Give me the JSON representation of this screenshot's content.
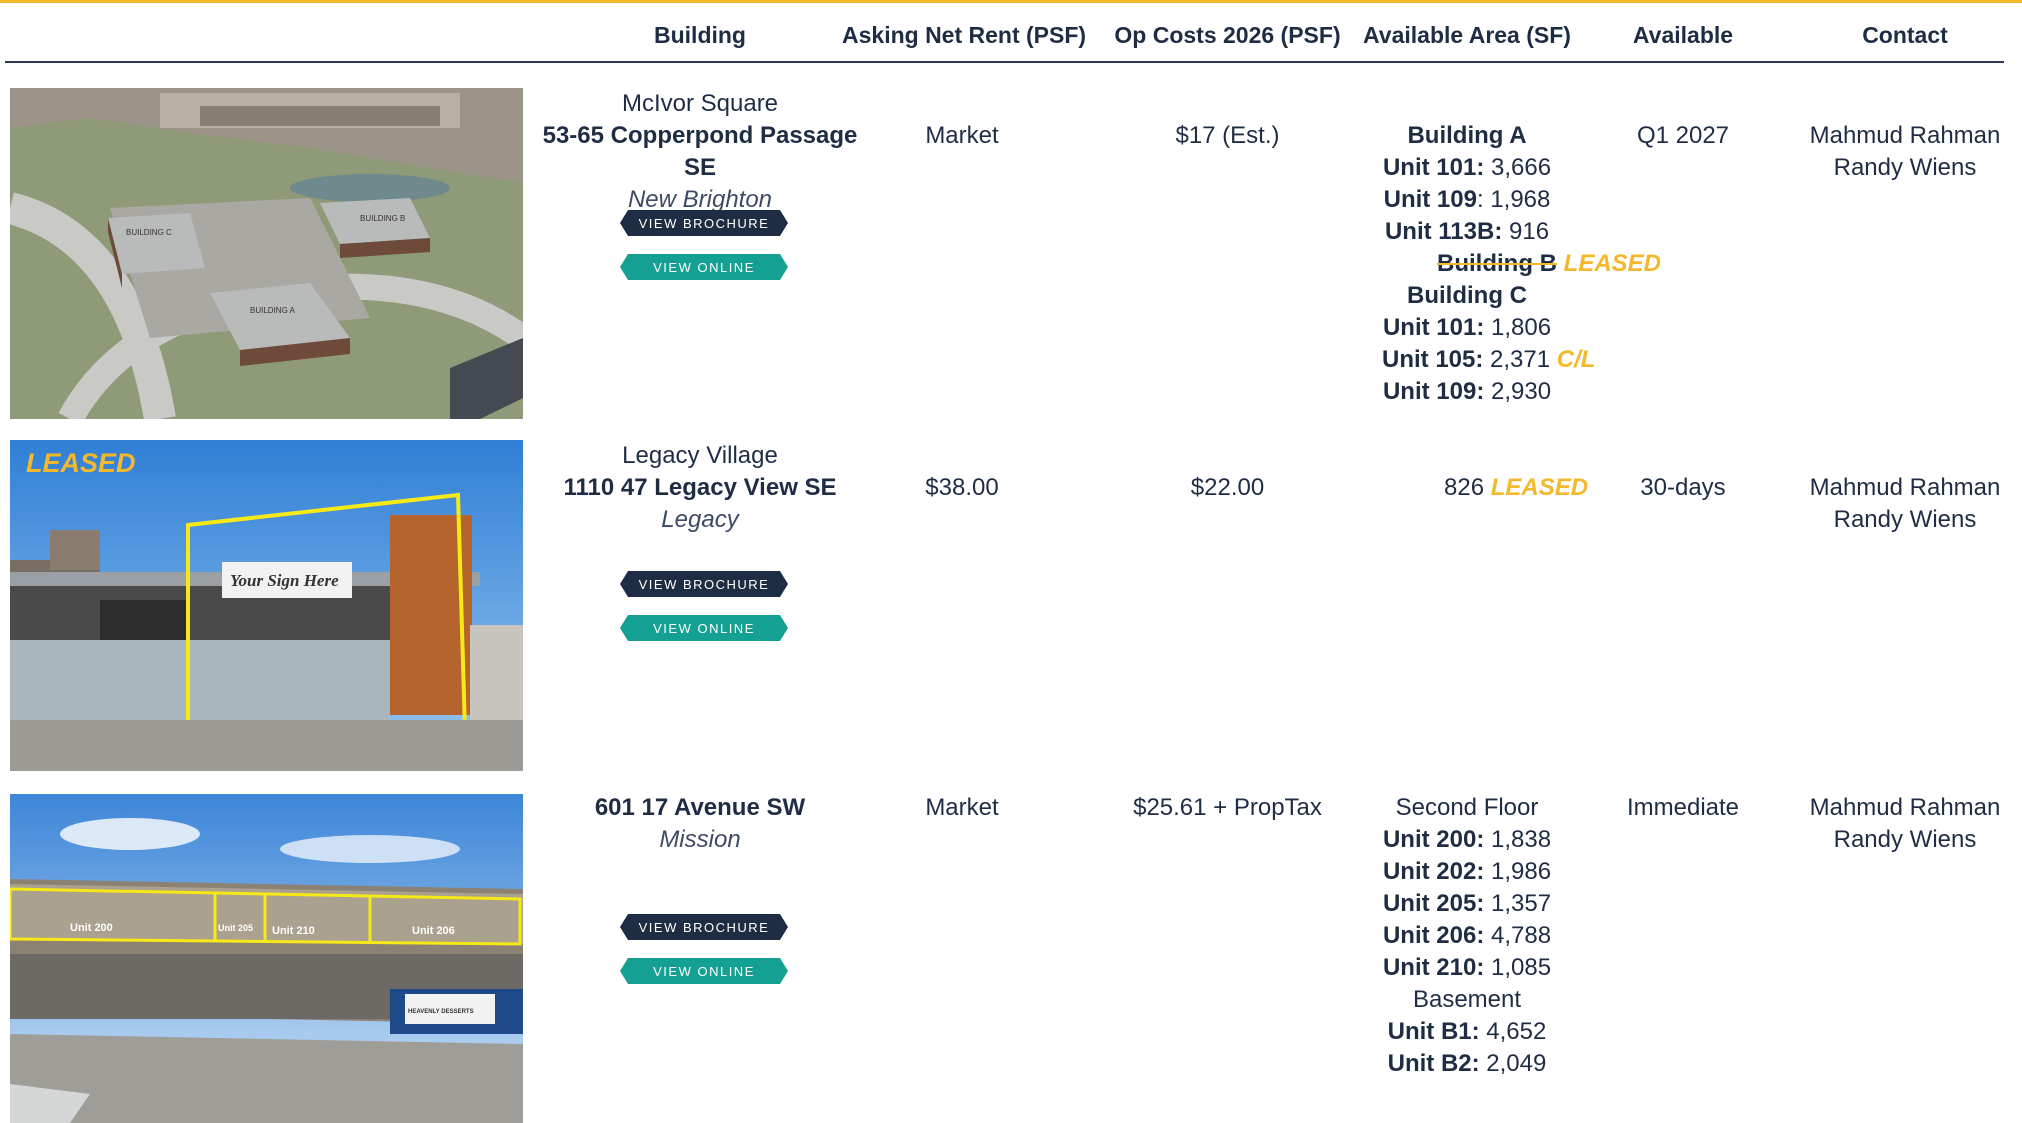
{
  "headers": {
    "building": "Building",
    "asking": "Asking Net Rent (PSF)",
    "opcosts": "Op Costs 2026 (PSF)",
    "area": "Available Area (SF)",
    "available": "Available",
    "contact": "Contact"
  },
  "buttons": {
    "brochure": "VIEW BROCHURE",
    "online": "VIEW ONLINE"
  },
  "colors": {
    "accent": "#f3b82c",
    "navy": "#1f2d44",
    "teal": "#14a193"
  },
  "rows": [
    {
      "photo_labels": [
        "BUILDING C",
        "BUILDING B",
        "BUILDING A"
      ],
      "name": "McIvor Square",
      "address": "53-65 Copperpond Passage SE",
      "area": "New Brighton",
      "asking": "Market",
      "opcosts": "$17 (Est.)",
      "available": "Q1 2027",
      "contact": [
        "Mahmud Rahman",
        "Randy Wiens"
      ],
      "units": {
        "bldg_a": "Building A",
        "a1_label": "Unit 101:",
        "a1_val": " 3,666",
        "a2_label": "Unit 109",
        "a2_val": ": 1,968",
        "a3_label": "Unit 113B:",
        "a3_val": " 916",
        "bldg_b": "Building B",
        "bldg_b_status": "LEASED",
        "bldg_c": "Building C",
        "c1_label": "Unit 101:",
        "c1_val": " 1,806",
        "c2_label": "Unit 105:",
        "c2_val": " 2,371",
        "c2_status": "C/L",
        "c3_label": "Unit 109:",
        "c3_val": " 2,930"
      }
    },
    {
      "leased_tag": "LEASED",
      "sign_text": "Your Sign Here",
      "name": "Legacy Village",
      "address": "1110 47 Legacy View SE",
      "area": "Legacy",
      "asking": "$38.00",
      "opcosts": "$22.00",
      "area_value": "826",
      "area_status": "LEASED",
      "available": "30-days",
      "contact": [
        "Mahmud Rahman",
        "Randy Wiens"
      ]
    },
    {
      "photo_labels": [
        "Unit 200",
        "Unit 205",
        "Unit 210",
        "Unit 206",
        "HEAVENLY DESSERTS"
      ],
      "address": "601 17 Avenue SW",
      "area": "Mission",
      "asking": "Market",
      "opcosts": "$25.61 + PropTax",
      "available": "Immediate",
      "contact": [
        "Mahmud Rahman",
        "Randy Wiens"
      ],
      "units": {
        "second_floor": "Second Floor",
        "u1_label": "Unit 200:",
        "u1_val": " 1,838",
        "u2_label": "Unit 202:",
        "u2_val": " 1,986",
        "u3_label": "Unit 205:",
        "u3_val": " 1,357",
        "u4_label": "Unit 206:",
        "u4_val": " 4,788",
        "u5_label": "Unit 210:",
        "u5_val": " 1,085",
        "basement": "Basement",
        "b1_label": "Unit B1:",
        "b1_val": " 4,652",
        "b2_label": "Unit B2:",
        "b2_val": " 2,049"
      }
    }
  ]
}
